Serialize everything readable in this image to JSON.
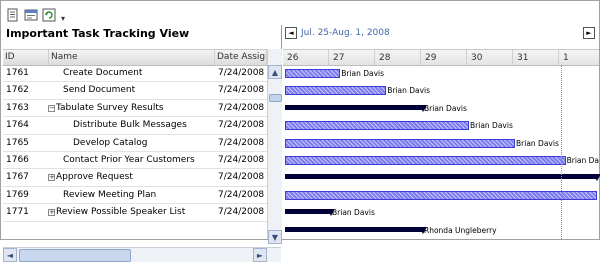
{
  "toolbar": {
    "buttons": [
      "new-task-icon",
      "properties-icon",
      "refresh-icon"
    ],
    "more_glyph": "▾"
  },
  "view_title": "Important Task Tracking View",
  "columns": {
    "id": "ID",
    "name": "Name",
    "date": "Date Assign"
  },
  "tasks": [
    {
      "id": "1761",
      "name": "Create Document",
      "date": "7/24/2008",
      "indent": 1,
      "expander": ""
    },
    {
      "id": "1762",
      "name": "Send Document",
      "date": "7/24/2008",
      "indent": 1,
      "expander": ""
    },
    {
      "id": "1763",
      "name": "Tabulate Survey Results",
      "date": "7/24/2008",
      "indent": 0,
      "expander": "−"
    },
    {
      "id": "1764",
      "name": "Distribute Bulk Messages",
      "date": "7/24/2008",
      "indent": 2,
      "expander": ""
    },
    {
      "id": "1765",
      "name": "Develop Catalog",
      "date": "7/24/2008",
      "indent": 2,
      "expander": ""
    },
    {
      "id": "1766",
      "name": "Contact Prior Year Customers",
      "date": "7/24/2008",
      "indent": 1,
      "expander": ""
    },
    {
      "id": "1767",
      "name": "Approve Request",
      "date": "7/24/2008",
      "indent": 0,
      "expander": "+"
    },
    {
      "id": "1769",
      "name": "Review Meeting Plan",
      "date": "7/24/2008",
      "indent": 1,
      "expander": ""
    },
    {
      "id": "1771",
      "name": "Review Possible Speaker List",
      "date": "7/24/2008",
      "indent": 0,
      "expander": "+"
    }
  ],
  "timeline": {
    "range_label": "Jul. 25-Aug. 1, 2008",
    "prev_glyph": "◄",
    "next_glyph": "►",
    "days": [
      "26",
      "27",
      "28",
      "29",
      "30",
      "31",
      "1"
    ]
  },
  "gantt_rows": [
    {
      "type": "task",
      "start_day": 0,
      "end_day": 1.2,
      "resource": "Brian Davis"
    },
    {
      "type": "task",
      "start_day": 0,
      "end_day": 2.2,
      "resource": "Brian Davis"
    },
    {
      "type": "summary",
      "start_day": 0,
      "end_day": 3.0,
      "resource": "Brian Davis"
    },
    {
      "type": "task",
      "start_day": 0,
      "end_day": 4.0,
      "resource": "Brian Davis"
    },
    {
      "type": "task",
      "start_day": 0,
      "end_day": 5.0,
      "resource": "Brian Davis"
    },
    {
      "type": "task",
      "start_day": 0,
      "end_day": 6.1,
      "resource": "Brian Da"
    },
    {
      "type": "summary",
      "start_day": 0,
      "end_day": 6.9,
      "resource": ""
    },
    {
      "type": "task",
      "start_day": 0,
      "end_day": 6.9,
      "resource": ""
    },
    {
      "type": "summary",
      "start_day": 0,
      "end_day": 1.0,
      "resource": "Brian Davis"
    },
    {
      "type": "summary",
      "start_day": 0,
      "end_day": 3.0,
      "resource": "Rhonda Ungleberry"
    }
  ],
  "colors": {
    "task_bar": "#7c7cf0",
    "task_border": "#3b3bd6",
    "summary_bar": "#000038",
    "range_text": "#4466aa"
  }
}
